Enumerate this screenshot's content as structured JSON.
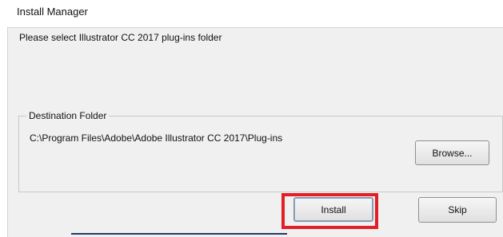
{
  "window": {
    "title": "Install Manager"
  },
  "dialog": {
    "prompt": "Please select Illustrator CC 2017 plug-ins folder",
    "destination": {
      "label": "Destination Folder",
      "path": "C:\\Program Files\\Adobe\\Adobe Illustrator CC 2017\\Plug-ins",
      "browse_label": "Browse..."
    },
    "buttons": {
      "install_label": "Install",
      "skip_label": "Skip"
    }
  },
  "colors": {
    "highlight": "#e41e26",
    "dialog_bg": "#f0f0f0"
  }
}
